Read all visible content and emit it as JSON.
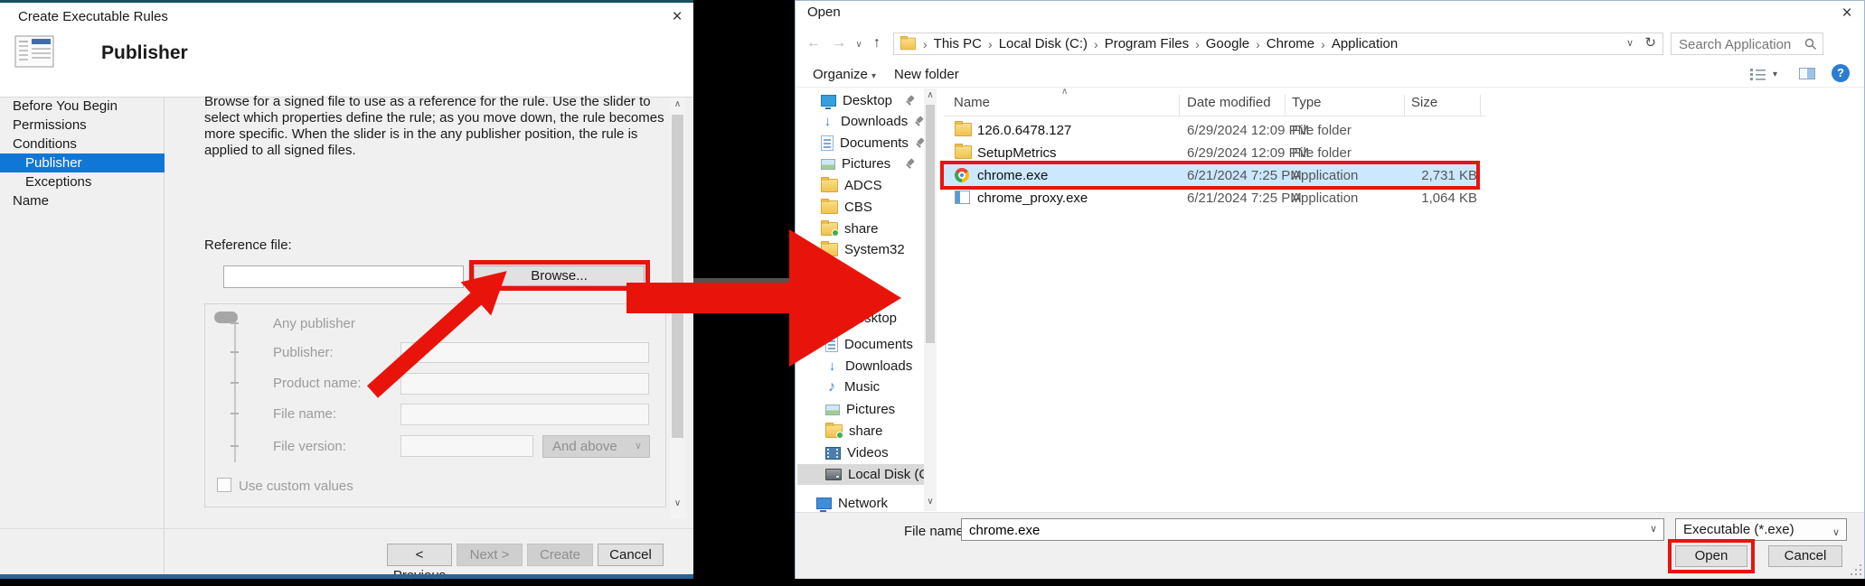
{
  "glyphs": {
    "close": "×",
    "back": "←",
    "forward": "→",
    "up": "↑",
    "refresh": "↻",
    "caret_down": "▾",
    "chevron_down": "∨",
    "chevron_up": "∧",
    "sort_ascending": "∧",
    "breadcrumb_separator": "›",
    "music_note": "♪",
    "download_arrow": "↓",
    "help": "?"
  },
  "left_dialog": {
    "title": "Create Executable Rules",
    "heading": "Publisher",
    "sidebar_items": [
      {
        "label": "Before You Begin",
        "selected": false
      },
      {
        "label": "Permissions",
        "selected": false
      },
      {
        "label": "Conditions",
        "selected": false
      },
      {
        "label": "Publisher",
        "selected": true
      },
      {
        "label": "Exceptions",
        "selected": false
      },
      {
        "label": "Name",
        "selected": false
      }
    ],
    "description": "Browse for a signed file to use as a reference for the rule. Use the slider to select which properties define the rule; as you move down, the rule becomes more specific. When the slider is in the any publisher position, the rule is applied to all signed files.",
    "reference_file_label": "Reference file:",
    "reference_file_value": "",
    "browse_button": "Browse...",
    "slider": {
      "any_publisher_label": "Any publisher",
      "publisher_label": "Publisher:",
      "product_name_label": "Product name:",
      "file_name_label": "File name:",
      "file_version_label": "File version:",
      "file_version_scope": "And above",
      "publisher_value": "",
      "product_name_value": "",
      "file_name_value": "",
      "file_version_value": ""
    },
    "use_custom_values_label": "Use custom values",
    "buttons": {
      "previous": "< Previous",
      "next": "Next >",
      "create": "Create",
      "cancel": "Cancel"
    }
  },
  "right_dialog": {
    "title": "Open",
    "breadcrumb": [
      "This PC",
      "Local Disk (C:)",
      "Program Files",
      "Google",
      "Chrome",
      "Application"
    ],
    "search_placeholder": "Search Application",
    "toolbar": {
      "organize": "Organize",
      "new_folder": "New folder"
    },
    "sidebar": {
      "pinned": [
        {
          "label": "Desktop",
          "icon": "desktop-icon"
        },
        {
          "label": "Downloads",
          "icon": "download-icon"
        },
        {
          "label": "Documents",
          "icon": "document-icon"
        },
        {
          "label": "Pictures",
          "icon": "picture-icon"
        },
        {
          "label": "ADCS",
          "icon": "folder-icon"
        },
        {
          "label": "CBS",
          "icon": "folder-icon"
        },
        {
          "label": "share",
          "icon": "shared-folder-icon"
        },
        {
          "label": "System32",
          "icon": "folder-icon"
        }
      ],
      "this_pc": [
        {
          "label": "Desktop",
          "icon": "desktop-icon"
        },
        {
          "label": "Documents",
          "icon": "document-icon"
        },
        {
          "label": "Downloads",
          "icon": "download-icon"
        },
        {
          "label": "Music",
          "icon": "music-icon"
        },
        {
          "label": "Pictures",
          "icon": "picture-icon"
        },
        {
          "label": "share",
          "icon": "shared-folder-icon"
        },
        {
          "label": "Videos",
          "icon": "video-icon"
        },
        {
          "label": "Local Disk (C:)",
          "icon": "drive-icon",
          "selected": true
        }
      ],
      "network": {
        "label": "Network",
        "icon": "network-icon"
      }
    },
    "columns": {
      "name": "Name",
      "date_modified": "Date modified",
      "type": "Type",
      "size": "Size"
    },
    "files": [
      {
        "icon": "folder-icon",
        "name": "126.0.6478.127",
        "date": "6/29/2024 12:09 PM",
        "type": "File folder",
        "size": "",
        "selected": false
      },
      {
        "icon": "folder-icon",
        "name": "SetupMetrics",
        "date": "6/29/2024 12:09 PM",
        "type": "File folder",
        "size": "",
        "selected": false
      },
      {
        "icon": "chrome-icon",
        "name": "chrome.exe",
        "date": "6/21/2024 7:25 PM",
        "type": "Application",
        "size": "2,731 KB",
        "selected": true
      },
      {
        "icon": "app-window-icon",
        "name": "chrome_proxy.exe",
        "date": "6/21/2024 7:25 PM",
        "type": "Application",
        "size": "1,064 KB",
        "selected": false
      }
    ],
    "footer": {
      "file_name_label": "File name:",
      "file_name_value": "chrome.exe",
      "filter_value": "Executable (*.exe)",
      "open_button": "Open",
      "cancel_button": "Cancel"
    }
  },
  "colors": {
    "selection_blue": "#1177d7",
    "selected_row_blue": "#cce8ff",
    "annotation_red": "#e8140c",
    "sidebar_selected_gray": "#d9d9d9"
  }
}
